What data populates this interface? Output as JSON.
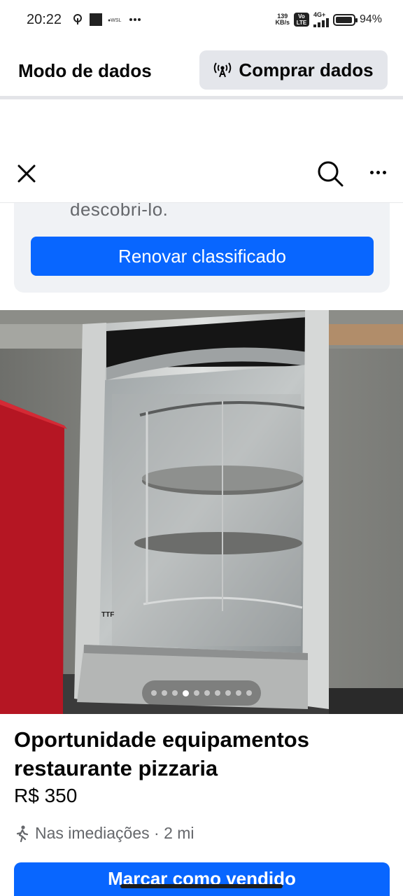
{
  "status_bar": {
    "time": "20:22",
    "speed_value": "139",
    "speed_unit": "KB/s",
    "volte_line1": "Vo",
    "volte_line2": "LTE",
    "network": "4G+",
    "battery": "94%",
    "battery_level": 0.94
  },
  "data_bar": {
    "title": "Modo de dados",
    "buy_label": "Comprar dados"
  },
  "renew_card": {
    "partial_text": "descobri-lo.",
    "button_label": "Renovar classificado"
  },
  "gallery": {
    "image_count": 10,
    "active_index": 3
  },
  "listing": {
    "title": "Oportunidade equipamentos restaurante pizzaria",
    "price": "R$ 350",
    "location": "Nas imediações · 2 mi",
    "bottom_button": "Marcar como vendido"
  },
  "colors": {
    "accent": "#0866ff",
    "secondary_text": "#65676b"
  },
  "icons": [
    "close-icon",
    "search-icon",
    "more-icon",
    "broadcast-icon",
    "walking-person-icon"
  ]
}
